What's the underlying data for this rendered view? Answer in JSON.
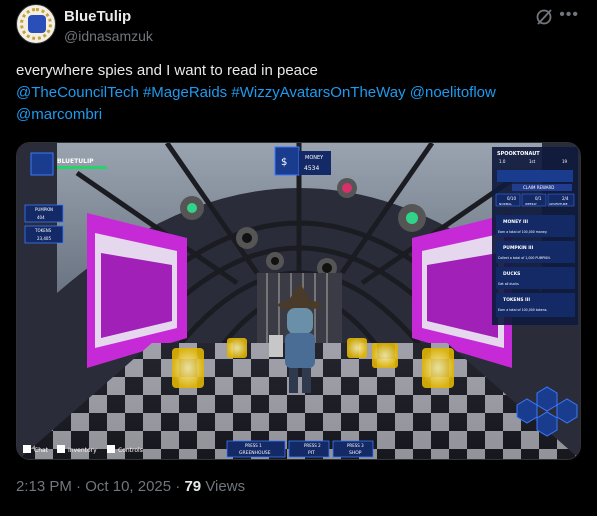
{
  "tweet": {
    "display_name": "BlueTulip",
    "handle": "@idnasamzuk",
    "text_plain": "everywhere spies and I want to read in peace",
    "hashtags": [
      "@TheCouncilTech",
      "#MageRaids",
      "#WizzyAvatarsOnTheWay",
      "@noelitoflow",
      "@marcombri"
    ],
    "time": "2:13 PM",
    "date": "Oct 10, 2025",
    "views_count": "79",
    "views_label": "Views"
  },
  "game_hud": {
    "player_name": "BLUETULIP",
    "money_label": "MONEY",
    "money_value": "4534",
    "inventory": [
      {
        "name": "PUMPKIN",
        "value": "404"
      },
      {
        "name": "TOKENS",
        "value": "23,405"
      }
    ],
    "quest_panel": {
      "player": "SPOOKTONAUT",
      "level": "1.0",
      "rank": "1st",
      "stat": "19",
      "claim_label": "CLAIM REWARD",
      "tabs": [
        "0/10",
        "0/1",
        "2/4"
      ],
      "tab_names": [
        "NORMAL",
        "WEEKLY",
        "ADVENTURE"
      ],
      "quests": [
        {
          "title": "MONEY III",
          "desc": "Earn a total of 100,000 money."
        },
        {
          "title": "PUMPKIN III",
          "desc": "Collect a total of 1,000 PUMPKIN."
        },
        {
          "title": "DUCKS",
          "desc": "Get all ducks"
        },
        {
          "title": "TOKENS III",
          "desc": "Earn a total of 100,000 tokens."
        }
      ]
    },
    "bottom_left": [
      {
        "key": "↵",
        "label": "Chat"
      },
      {
        "key": "I",
        "label": "Inventory"
      },
      {
        "key": "?",
        "label": "Controls"
      }
    ],
    "bottom_center": [
      {
        "press": "PRESS 1",
        "label": "GREENHOUSE"
      },
      {
        "press": "PRESS 2",
        "label": "PIT"
      },
      {
        "press": "PRESS 3",
        "label": "SHOP"
      }
    ]
  },
  "colors": {
    "link": "#1d9bf0",
    "muted": "#71767b",
    "neon_magenta": "#c62ad6",
    "hud_blue": "#1a3c8f"
  }
}
